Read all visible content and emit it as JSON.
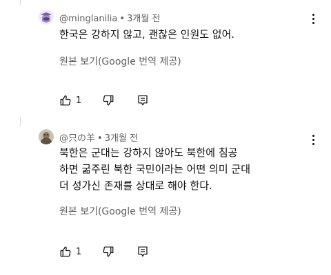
{
  "comments": [
    {
      "author": "@minglanilia",
      "separator": "•",
      "time": "3개월 전",
      "lines": [
        "한국은 강하지 않고, 괜찮은 인원도 없어."
      ],
      "translate_label": "원본 보기(Google 번역 제공)",
      "likes": "1",
      "avatar_color": "#7d5ea8",
      "icons": [
        "like-icon",
        "dislike-icon",
        "reply-icon",
        "more-vert-icon"
      ]
    },
    {
      "author": "@只の羊",
      "separator": "•",
      "time": "3개월 전",
      "lines": [
        "북한은 군대는 강하지 않아도 북한에 침공",
        "하면 굶주린 북한 국민이라는 어떤 의미 군대",
        "더 성가신 존재를 상대로 해야 한다."
      ],
      "translate_label": "원본 보기(Google 번역 제공)",
      "likes": "1",
      "avatar_color": "#8a7a5a",
      "icons": [
        "like-icon",
        "dislike-icon",
        "reply-icon",
        "more-vert-icon"
      ]
    }
  ],
  "colors": {
    "text_primary": "#0f0f0f",
    "text_secondary": "#606060",
    "thread_line": "#d9d9d9",
    "background": "#ffffff"
  }
}
